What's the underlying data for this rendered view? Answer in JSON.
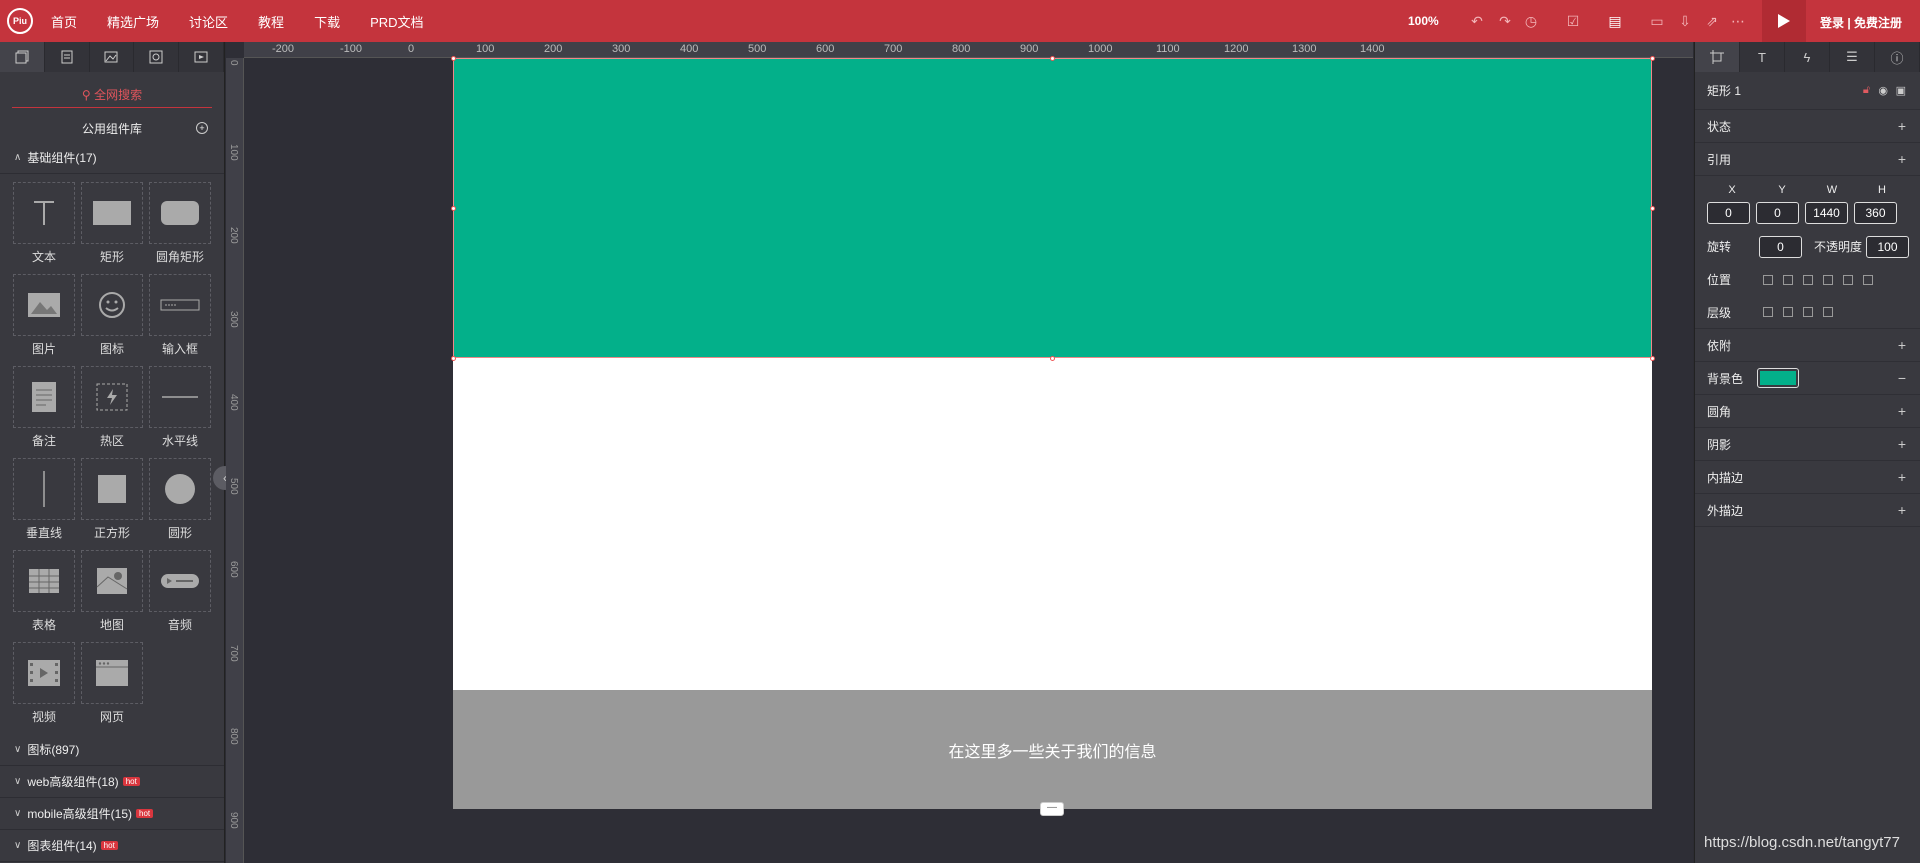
{
  "topbar": {
    "logo": "Piu",
    "nav": [
      "首页",
      "精选广场",
      "讨论区",
      "教程",
      "下载",
      "PRD文档"
    ],
    "zoom": "100%",
    "login": "登录 | 免费注册"
  },
  "left_panel": {
    "search_label": "全网搜索",
    "library_title": "公用组件库",
    "basic_section": "基础组件(17)",
    "components": [
      "文本",
      "矩形",
      "圆角矩形",
      "图片",
      "图标",
      "输入框",
      "备注",
      "热区",
      "水平线",
      "垂直线",
      "正方形",
      "圆形",
      "表格",
      "地图",
      "音频",
      "视频",
      "网页"
    ],
    "sections": [
      {
        "label": "图标(897)",
        "hot": ""
      },
      {
        "label": "web高级组件(18)",
        "hot": "hot"
      },
      {
        "label": "mobile高级组件(15)",
        "hot": "hot"
      },
      {
        "label": "图表组件(14)",
        "hot": "hot"
      }
    ]
  },
  "ruler": {
    "h_ticks": [
      "-200",
      "-100",
      "0",
      "100",
      "200",
      "300",
      "400",
      "500",
      "600",
      "700",
      "800",
      "900",
      "1000",
      "1100",
      "1200",
      "1300",
      "1400"
    ],
    "v_ticks": [
      "0",
      "100",
      "200",
      "300",
      "400",
      "500",
      "600",
      "700",
      "800",
      "900"
    ]
  },
  "canvas": {
    "footer_text": "在这里多一些关于我们的信息",
    "header_color": "#03b08a",
    "footer_color": "#999999"
  },
  "right_panel": {
    "element_name": "矩形 1",
    "rows_top": [
      "状态",
      "引用"
    ],
    "labels": {
      "x": "X",
      "y": "Y",
      "w": "W",
      "h": "H"
    },
    "values": {
      "x": "0",
      "y": "0",
      "w": "1440",
      "h": "360",
      "rotation": "0",
      "opacity": "100"
    },
    "rotation_label": "旋转",
    "opacity_label": "不透明度",
    "position_label": "位置",
    "layer_label": "层级",
    "attach_label": "依附",
    "bg_label": "背景色",
    "bg_color": "#03b08a",
    "rows_bottom": [
      "圆角",
      "阴影",
      "内描边",
      "外描边"
    ]
  },
  "watermark": "https://blog.csdn.net/tangyt77"
}
